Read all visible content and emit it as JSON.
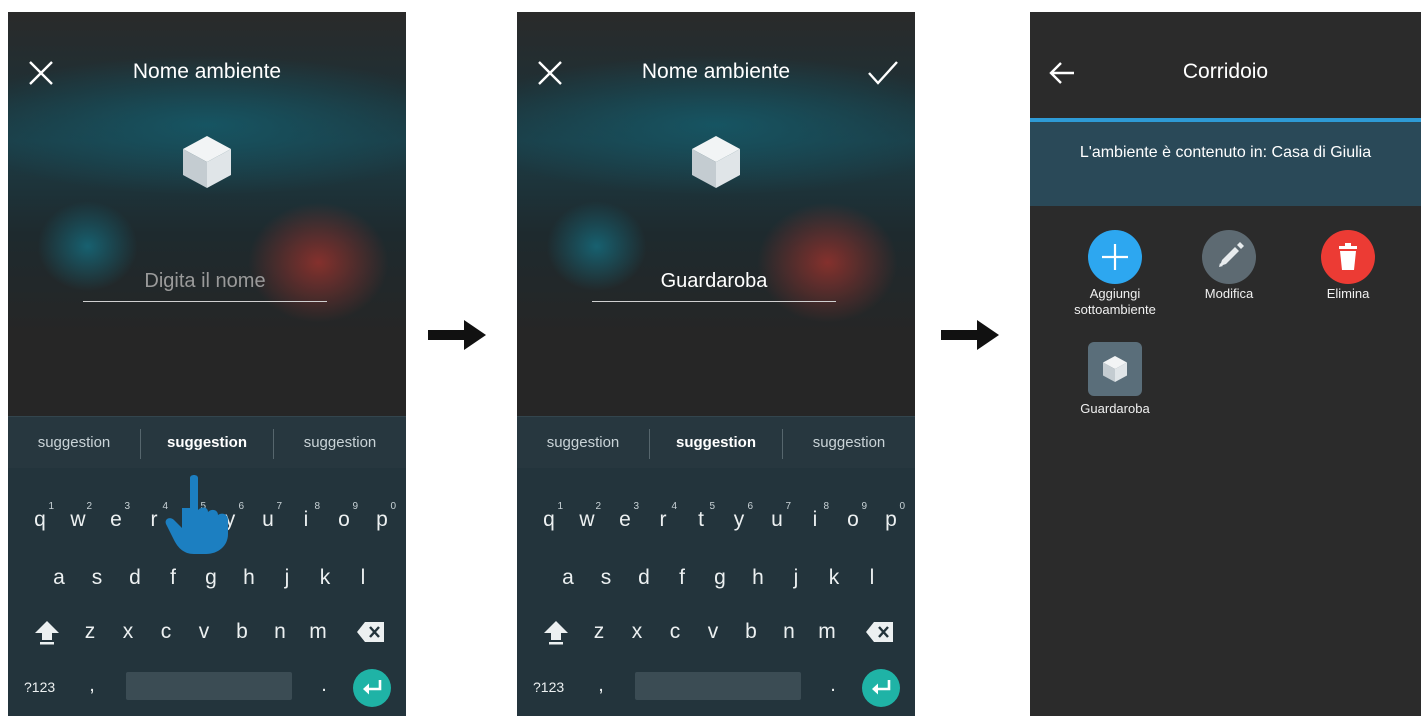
{
  "screen1": {
    "title": "Nome ambiente",
    "input_placeholder": "Digita il nome",
    "suggestions": [
      "suggestion",
      "suggestion",
      "suggestion"
    ]
  },
  "screen2": {
    "title": "Nome ambiente",
    "input_value": "Guardaroba",
    "suggestions": [
      "suggestion",
      "suggestion",
      "suggestion"
    ]
  },
  "keyboard": {
    "row1": [
      "q",
      "w",
      "e",
      "r",
      "t",
      "y",
      "u",
      "i",
      "o",
      "p"
    ],
    "row1_numbers": [
      "1",
      "2",
      "3",
      "4",
      "5",
      "6",
      "7",
      "8",
      "9",
      "0"
    ],
    "row2": [
      "a",
      "s",
      "d",
      "f",
      "g",
      "h",
      "j",
      "k",
      "l"
    ],
    "row3": [
      "z",
      "x",
      "c",
      "v",
      "b",
      "n",
      "m"
    ],
    "symbols_label": "?123",
    "comma": ",",
    "period": "."
  },
  "screen3": {
    "title": "Corridoio",
    "info_text": "L'ambiente è contenuto in: Casa di Giulia",
    "actions": [
      {
        "label_line1": "Aggiungi",
        "label_line2": "sottoambiente",
        "icon": "plus-icon",
        "color": "#2da7f0"
      },
      {
        "label_line1": "Modifica",
        "label_line2": "",
        "icon": "pencil-icon",
        "color": "#5d6a72"
      },
      {
        "label_line1": "Elimina",
        "label_line2": "",
        "icon": "trash-icon",
        "color": "#ec3b34"
      }
    ],
    "subroom": {
      "label": "Guardaroba",
      "icon": "cube-icon"
    }
  },
  "colors": {
    "accent_teal": "#1fb3a6",
    "accent_blue": "#2e9bd6",
    "keyboard_bg": "#23343c"
  }
}
